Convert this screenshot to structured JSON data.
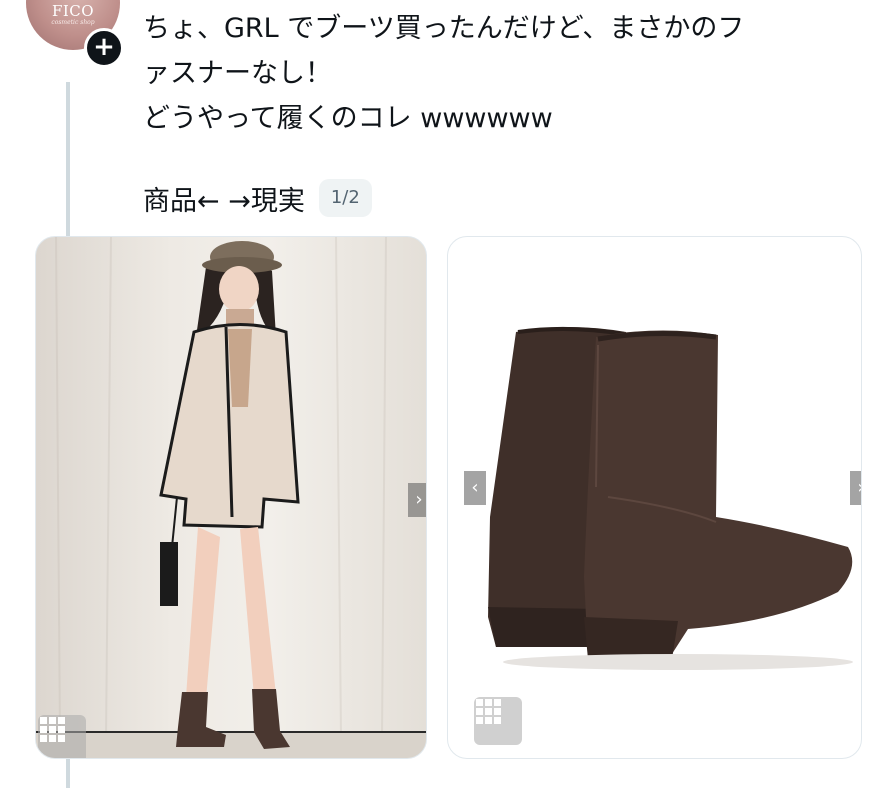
{
  "author": {
    "avatar_logo": "FICO",
    "avatar_subtitle": "cosmetic shop",
    "follow_icon": "plus-icon"
  },
  "tweet": {
    "line1": "ちょ、GRL でブーツ買ったんだけど、まさかのフ",
    "line2": "ァスナーなし！",
    "line3": "どうやって履くのコレ wwwwww"
  },
  "media": {
    "caption": "商品← →現実",
    "page_indicator": "1/2",
    "prev_glyph": "‹",
    "next_glyph": "›",
    "grid_icon": "grid-icon"
  },
  "colors": {
    "boot_brown": "#4a3730",
    "coat_beige": "#e6d9cc",
    "pill_bg": "#eff3f4"
  }
}
